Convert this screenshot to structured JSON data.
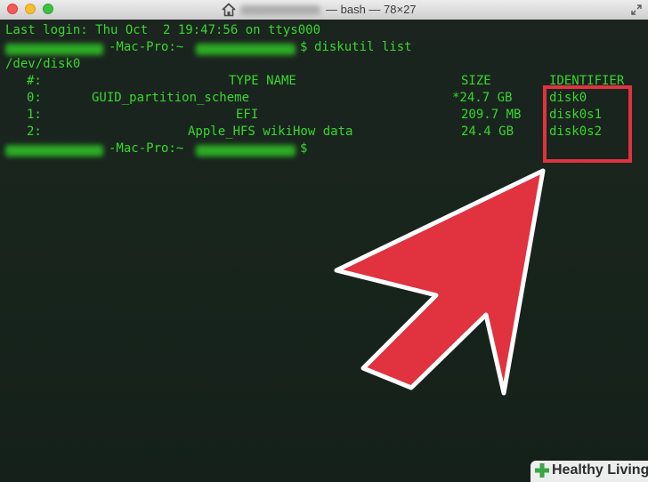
{
  "window": {
    "title_suffix": "— bash — 78×27",
    "home_icon": "house-icon",
    "resize_icon": "fullscreen-arrows-icon"
  },
  "terminal": {
    "last_login": "Last login: Thu Oct  2 19:47:56 on ttys000",
    "prompt_host": "-Mac-Pro:~",
    "prompt_char": "$",
    "command": "diskutil list",
    "disk": "/dev/disk0",
    "header": {
      "num": "#:",
      "type": "TYPE NAME",
      "size": "SIZE",
      "id": "IDENTIFIER"
    },
    "partitions": [
      {
        "num": "0:",
        "type": "GUID_partition_scheme",
        "size": "*24.7 GB",
        "id": "disk0"
      },
      {
        "num": "1:",
        "type": "EFI",
        "size": "209.7 MB",
        "id": "disk0s1"
      },
      {
        "num": "2:",
        "type": "Apple_HFS wikiHow data",
        "size": "24.4 GB",
        "id": "disk0s2"
      }
    ]
  },
  "annotation": {
    "box_color": "#e0323f",
    "arrow_color": "#e0323f"
  },
  "watermark": {
    "text": "Healthy Living",
    "icon": "plus-icon"
  }
}
